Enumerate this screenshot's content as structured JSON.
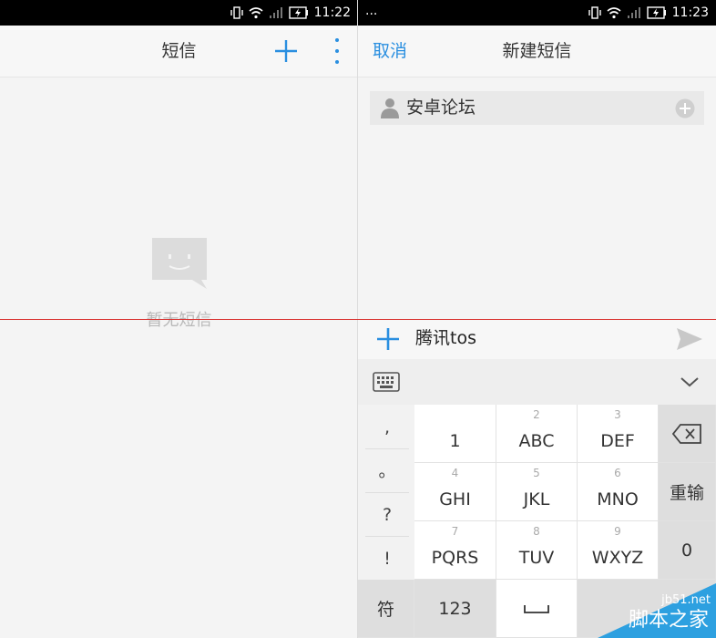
{
  "left_screen": {
    "status": {
      "time": "11:22"
    },
    "header": {
      "title": "短信"
    },
    "empty_text": "暂无短信"
  },
  "right_screen": {
    "status": {
      "dots": "...",
      "time": "11:23"
    },
    "header": {
      "cancel": "取消",
      "title": "新建短信"
    },
    "recipient": {
      "name": "安卓论坛"
    },
    "compose": {
      "text": "腾讯tos"
    },
    "keyboard": {
      "punct": [
        ",",
        "。",
        "?",
        "!"
      ],
      "keys": [
        {
          "sub": "",
          "main": "1"
        },
        {
          "sub": "2",
          "main": "ABC"
        },
        {
          "sub": "3",
          "main": "DEF"
        },
        {
          "sub": "4",
          "main": "GHI"
        },
        {
          "sub": "5",
          "main": "JKL"
        },
        {
          "sub": "6",
          "main": "MNO"
        },
        {
          "sub": "7",
          "main": "PQRS"
        },
        {
          "sub": "8",
          "main": "TUV"
        },
        {
          "sub": "9",
          "main": "WXYZ"
        }
      ],
      "reenter": "重输",
      "zero": "0",
      "symbol": "符",
      "num": "123"
    }
  },
  "watermark": {
    "site": "jb51.net",
    "text": "脚本之家"
  },
  "colors": {
    "accent": "#2a8fe0",
    "statusbar": "#000000",
    "marker_line": "#d9322f"
  }
}
